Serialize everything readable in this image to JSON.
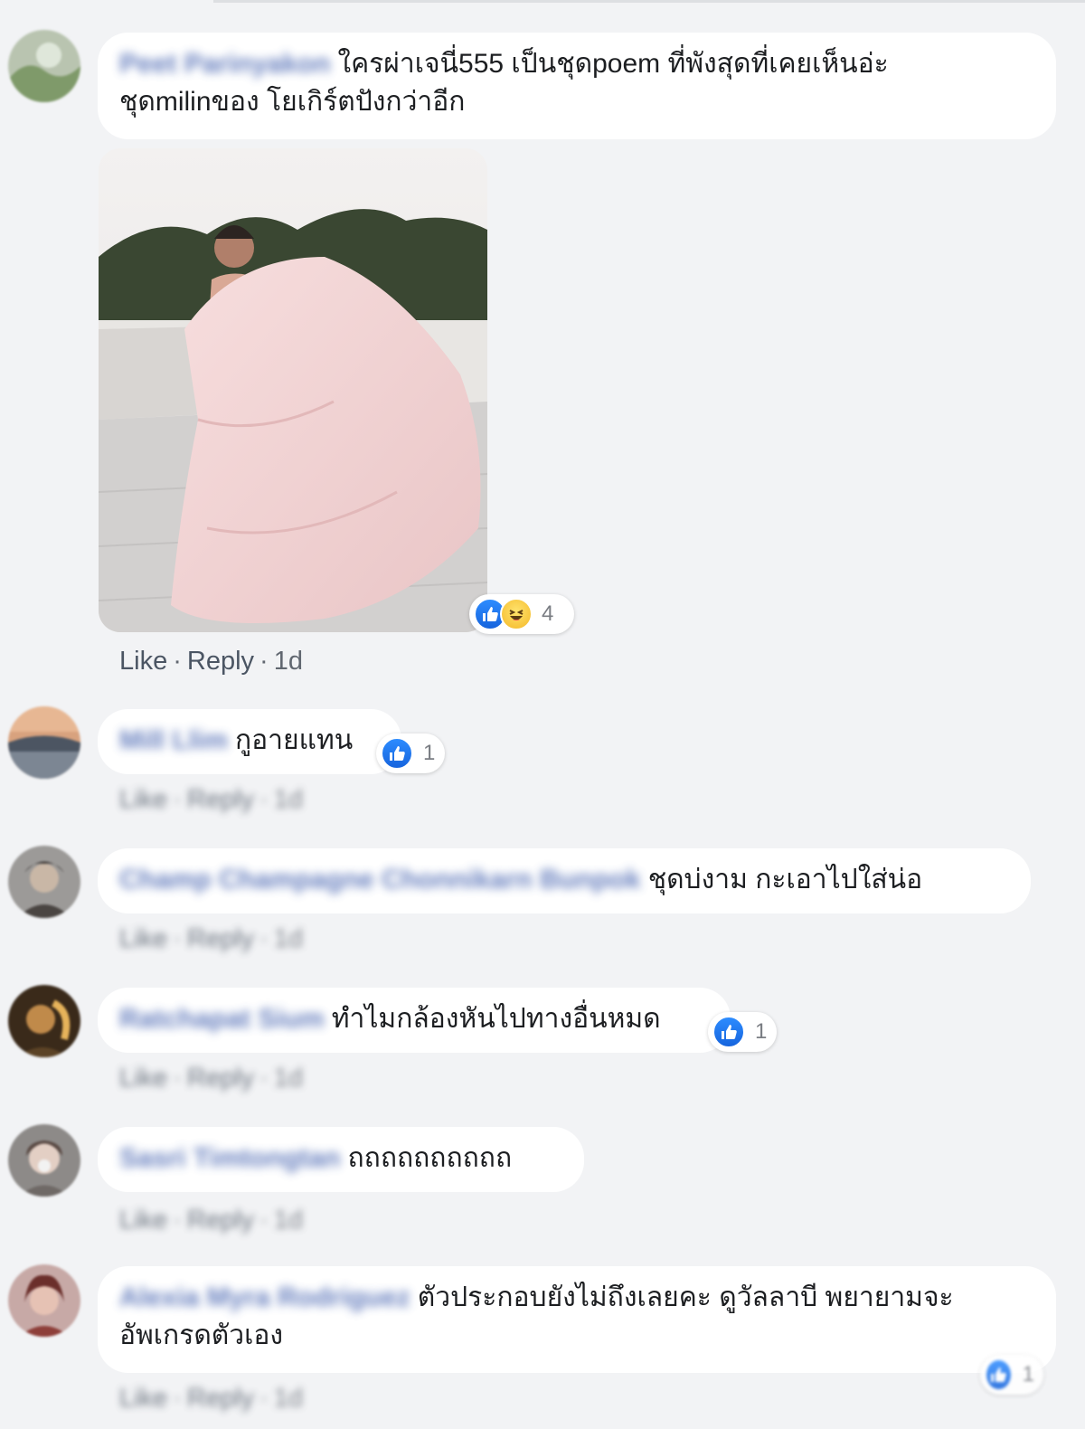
{
  "comments": [
    {
      "author": "Peet Parinyakon",
      "text_line1": "ใครผ่าเจนี่555 เป็นชุดpoem ที่พังสุดที่เคยเห็นอ่ะ",
      "text_line2": "ชุดmilinของ โยเกิร์ตปังกว่าอีก",
      "reaction_count": "4",
      "reaction_icons": [
        "like-icon",
        "haha-icon"
      ],
      "has_photo": true,
      "like": "Like",
      "reply": "Reply",
      "time": "1d"
    },
    {
      "author": "Mill Llim",
      "text": "กูอายแทน",
      "reaction_count": "1",
      "like": "Like",
      "reply": "Reply",
      "time": "1d"
    },
    {
      "author": "Champ Champagne Chonnikarn Bunpok",
      "text": "ชุดบ่งาม กะเอาไปใส่น่อ",
      "like": "Like",
      "reply": "Reply",
      "time": "1d"
    },
    {
      "author": "Ratchapat Sium",
      "text": "ทำไมกล้องหันไปทางอื่นหมด",
      "reaction_count": "1",
      "like": "Like",
      "reply": "Reply",
      "time": "1d"
    },
    {
      "author": "Sasri Timtongtan",
      "text": "ถถถถถถถถถถ",
      "like": "Like",
      "reply": "Reply",
      "time": "1d"
    },
    {
      "author": "Alexia Myra Rodriguez",
      "text_line1": "ตัวประกอบยังไม่ถึงเลยคะ ดูวัลลาบี พยายามจะ",
      "text_line2": "อัพเกรดตัวเอง",
      "reaction_count": "1",
      "like": "Like",
      "reply": "Reply",
      "time": "1d"
    }
  ],
  "colors": {
    "background": "#f2f3f5",
    "bubble": "#ffffff",
    "author": "#4a67b2",
    "like_blue": "#1877f2",
    "meta": "#616770"
  }
}
